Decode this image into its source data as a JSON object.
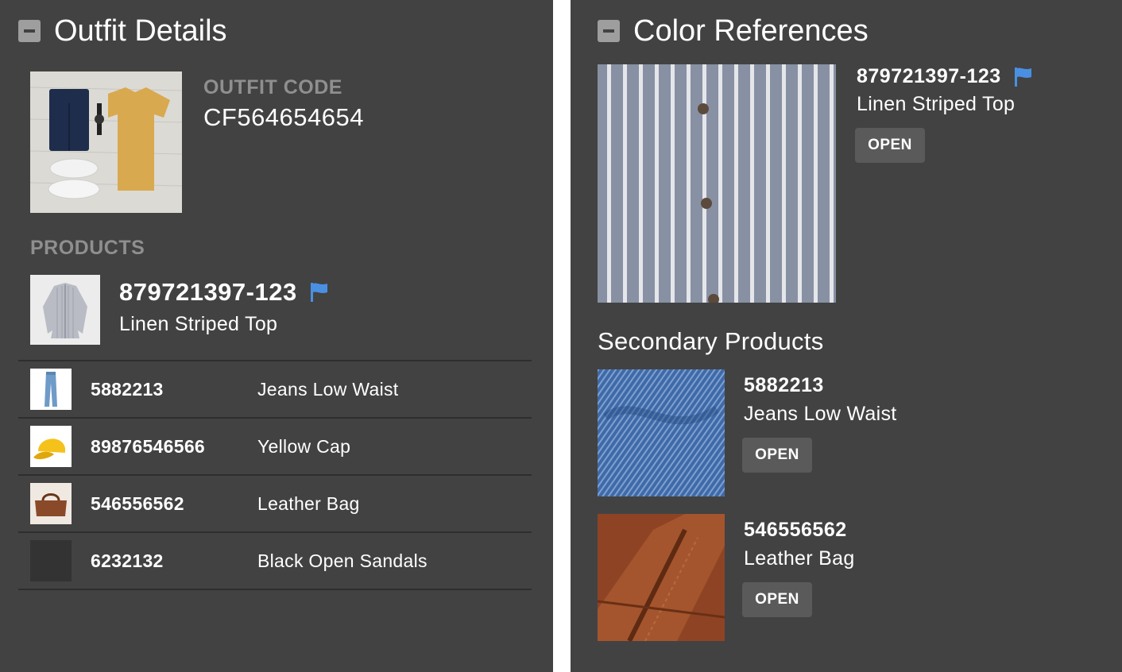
{
  "outfit": {
    "title": "Outfit Details",
    "code_label": "OUTFIT CODE",
    "code_value": "CF564654654",
    "products_label": "PRODUCTS",
    "primary": {
      "id": "879721397-123",
      "name": "Linen Striped Top"
    },
    "items": [
      {
        "id": "5882213",
        "name": "Jeans Low Waist"
      },
      {
        "id": "89876546566",
        "name": "Yellow Cap"
      },
      {
        "id": "546556562",
        "name": "Leather Bag"
      },
      {
        "id": "6232132",
        "name": "Black Open Sandals"
      }
    ]
  },
  "colors": {
    "title": "Color References",
    "reference": {
      "id": "879721397-123",
      "name": "Linen Striped Top",
      "button": "OPEN"
    },
    "secondary_title": "Secondary Products",
    "secondary": [
      {
        "id": "5882213",
        "name": "Jeans Low Waist",
        "button": "OPEN"
      },
      {
        "id": "546556562",
        "name": "Leather Bag",
        "button": "OPEN"
      }
    ]
  },
  "theme": {
    "panel_bg": "#424242",
    "flag_color": "#4a90e2",
    "muted_label": "#8f8f8f",
    "button_bg": "#5a5a5a"
  }
}
